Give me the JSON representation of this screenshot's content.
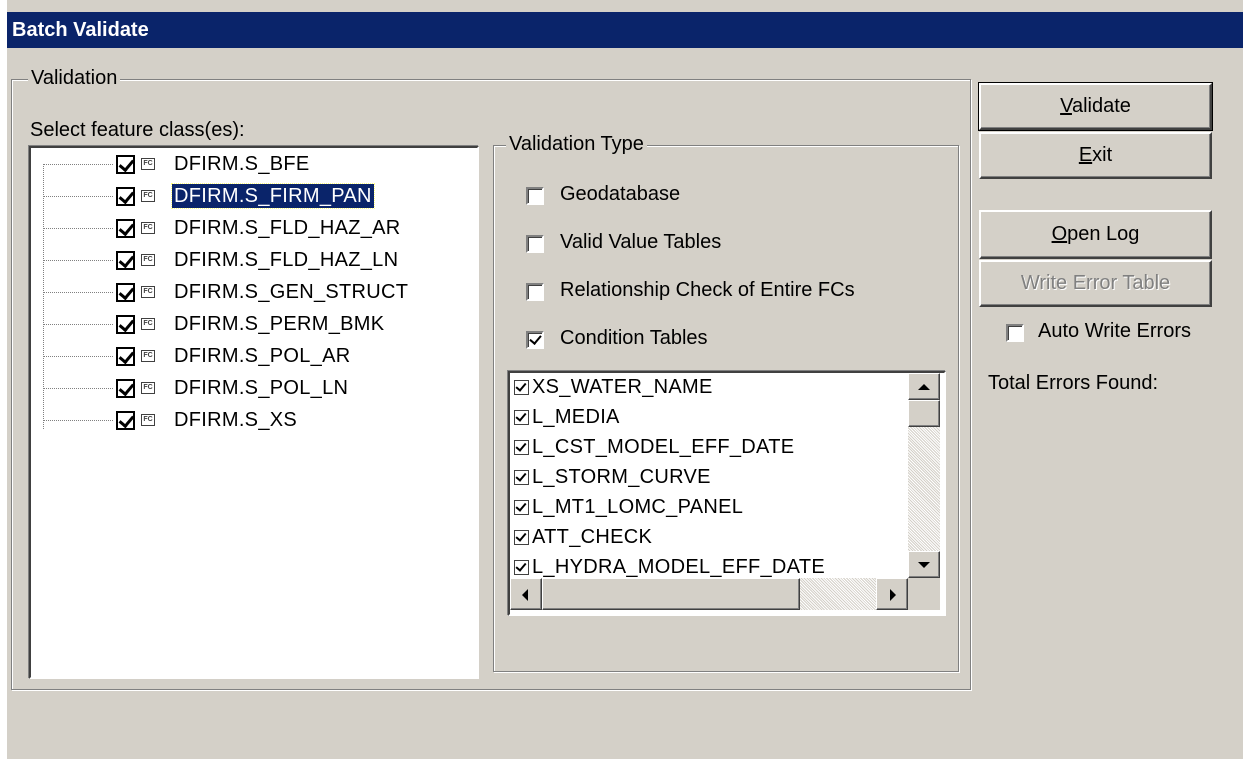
{
  "window": {
    "title": "Batch Validate"
  },
  "validation_group": {
    "label": "Validation",
    "select_label": "Select feature class(es):",
    "feature_classes": [
      {
        "name": "DFIRM.S_BFE",
        "checked": true,
        "selected": false
      },
      {
        "name": "DFIRM.S_FIRM_PAN",
        "checked": true,
        "selected": true
      },
      {
        "name": "DFIRM.S_FLD_HAZ_AR",
        "checked": true,
        "selected": false
      },
      {
        "name": "DFIRM.S_FLD_HAZ_LN",
        "checked": true,
        "selected": false
      },
      {
        "name": "DFIRM.S_GEN_STRUCT",
        "checked": true,
        "selected": false
      },
      {
        "name": "DFIRM.S_PERM_BMK",
        "checked": true,
        "selected": false
      },
      {
        "name": "DFIRM.S_POL_AR",
        "checked": true,
        "selected": false
      },
      {
        "name": "DFIRM.S_POL_LN",
        "checked": true,
        "selected": false
      },
      {
        "name": "DFIRM.S_XS",
        "checked": true,
        "selected": false
      }
    ],
    "fc_icon_text": "FC"
  },
  "validation_type": {
    "label": "Validation Type",
    "options": [
      {
        "label": "Geodatabase",
        "checked": false
      },
      {
        "label": "Valid Value Tables",
        "checked": false
      },
      {
        "label": "Relationship Check of Entire FCs",
        "checked": false
      },
      {
        "label": "Condition Tables",
        "checked": true
      }
    ],
    "condition_tables": [
      {
        "name": "XS_WATER_NAME",
        "checked": true
      },
      {
        "name": "L_MEDIA",
        "checked": true
      },
      {
        "name": "L_CST_MODEL_EFF_DATE",
        "checked": true
      },
      {
        "name": "L_STORM_CURVE",
        "checked": true
      },
      {
        "name": "L_MT1_LOMC_PANEL",
        "checked": true
      },
      {
        "name": "ATT_CHECK",
        "checked": true
      },
      {
        "name": "L_HYDRA_MODEL_EFF_DATE",
        "checked": true
      }
    ],
    "vertical_scroll_position": 0,
    "horizontal_scroll_position": 0
  },
  "buttons": {
    "validate": {
      "label": "Validate",
      "mnemonic": "V",
      "rest": "alidate",
      "enabled": true
    },
    "exit": {
      "label": "Exit",
      "mnemonic": "E",
      "rest": "xit",
      "enabled": true
    },
    "open_log": {
      "label": "Open Log",
      "mnemonic": "O",
      "rest": "pen Log",
      "enabled": true
    },
    "write_error_table": {
      "label": "Write Error Table",
      "enabled": false
    }
  },
  "auto_write_errors": {
    "label": "Auto Write Errors",
    "checked": false
  },
  "total_errors": {
    "label": "Total Errors Found:",
    "value": ""
  }
}
